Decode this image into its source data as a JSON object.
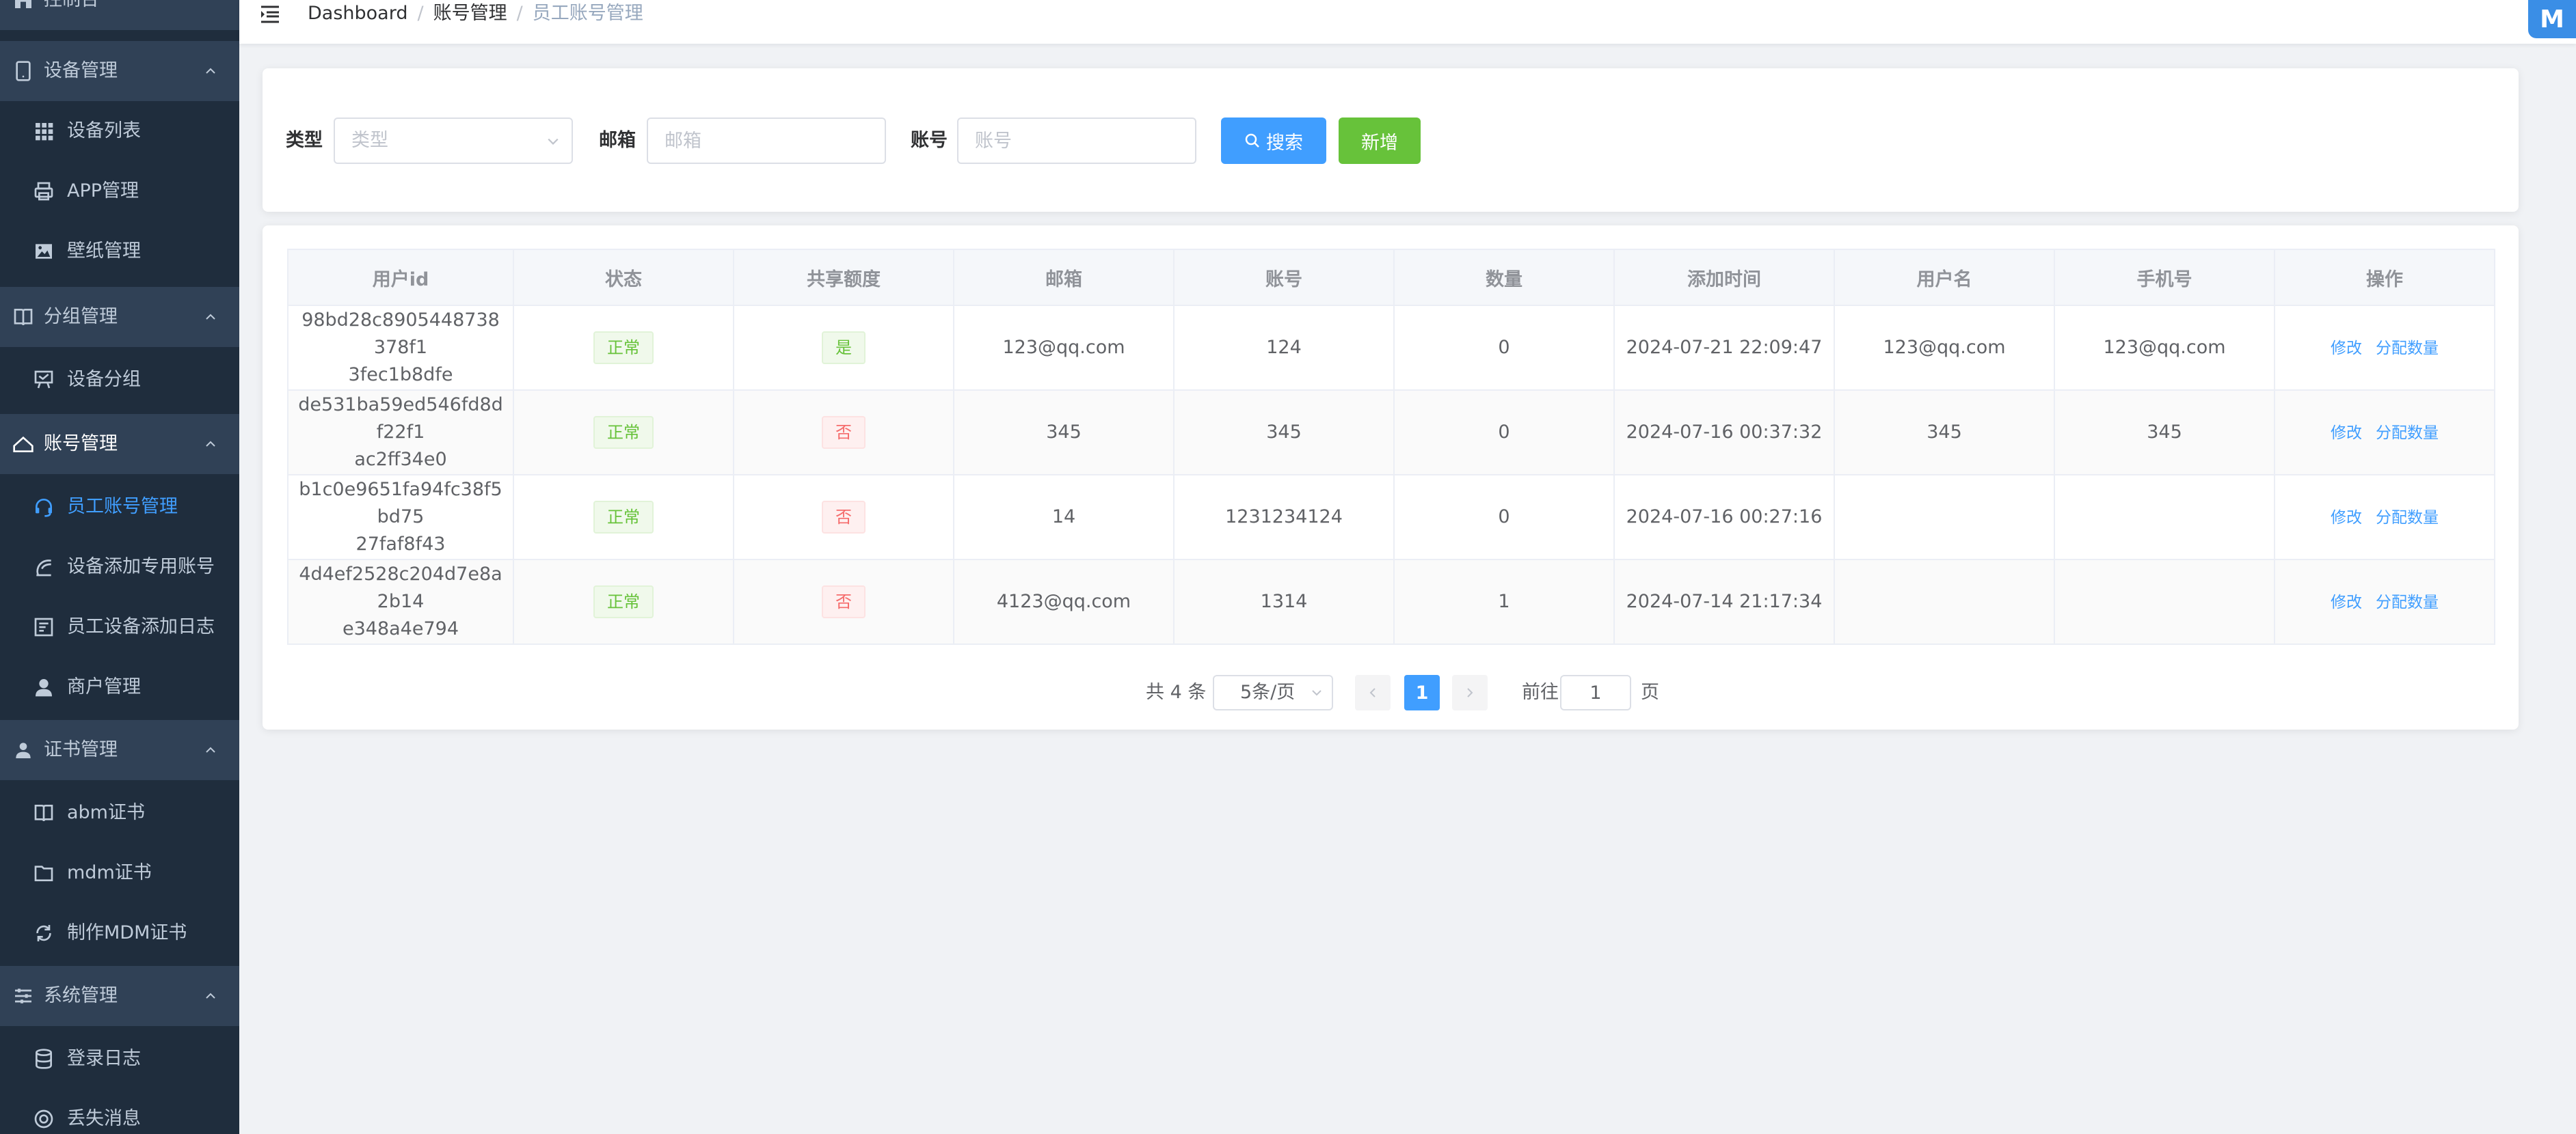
{
  "sidebar": {
    "top_partial": "控制台",
    "groups": [
      {
        "label": "设备管理",
        "items": [
          "设备列表",
          "APP管理",
          "壁纸管理"
        ]
      },
      {
        "label": "分组管理",
        "items": [
          "设备分组"
        ]
      },
      {
        "label": "账号管理",
        "items": [
          "员工账号管理",
          "设备添加专用账号",
          "员工设备添加日志",
          "商户管理"
        ]
      },
      {
        "label": "证书管理",
        "items": [
          "abm证书",
          "mdm证书",
          "制作MDM证书"
        ]
      },
      {
        "label": "系统管理",
        "items": [
          "登录日志",
          "丢失消息"
        ]
      }
    ],
    "active_item": "员工账号管理"
  },
  "header": {
    "breadcrumb": [
      "Dashboard",
      "账号管理",
      "员工账号管理"
    ],
    "avatar_text": "M"
  },
  "filter": {
    "type_label": "类型",
    "type_placeholder": "类型",
    "email_label": "邮箱",
    "email_placeholder": "邮箱",
    "account_label": "账号",
    "account_placeholder": "账号",
    "search_button": "搜索",
    "add_button": "新增"
  },
  "table": {
    "headers": [
      "用户id",
      "状态",
      "共享额度",
      "邮箱",
      "账号",
      "数量",
      "添加时间",
      "用户名",
      "手机号",
      "操作"
    ],
    "rows": [
      {
        "uid_line1": "98bd28c8905448738378f1",
        "uid_line2": "3fec1b8dfe",
        "status": "正常",
        "share": "是",
        "email": "123@qq.com",
        "account": "124",
        "count": "0",
        "time": "2024-07-21 22:09:47",
        "username": "123@qq.com",
        "phone": "123@qq.com"
      },
      {
        "uid_line1": "de531ba59ed546fd8df22f1",
        "uid_line2": "ac2ff34e0",
        "status": "正常",
        "share": "否",
        "email": "345",
        "account": "345",
        "count": "0",
        "time": "2024-07-16 00:37:32",
        "username": "345",
        "phone": "345"
      },
      {
        "uid_line1": "b1c0e9651fa94fc38f5bd75",
        "uid_line2": "27faf8f43",
        "status": "正常",
        "share": "否",
        "email": "14",
        "account": "1231234124",
        "count": "0",
        "time": "2024-07-16 00:27:16",
        "username": "",
        "phone": ""
      },
      {
        "uid_line1": "4d4ef2528c204d7e8a2b14",
        "uid_line2": "e348a4e794",
        "status": "正常",
        "share": "否",
        "email": "4123@qq.com",
        "account": "1314",
        "count": "1",
        "time": "2024-07-14 21:17:34",
        "username": "",
        "phone": ""
      }
    ],
    "actions": {
      "edit": "修改",
      "assign": "分配数量"
    }
  },
  "pagination": {
    "total_text": "共 4 条",
    "page_size": "5条/页",
    "current_page": "1",
    "goto_prefix": "前往",
    "goto_value": "1",
    "goto_suffix": "页"
  },
  "colors": {
    "sidebar_bg": "#1f2d3d",
    "sidebar_group_bg": "#304156",
    "primary": "#409eff",
    "success": "#67c23a",
    "danger": "#f56c6c"
  }
}
